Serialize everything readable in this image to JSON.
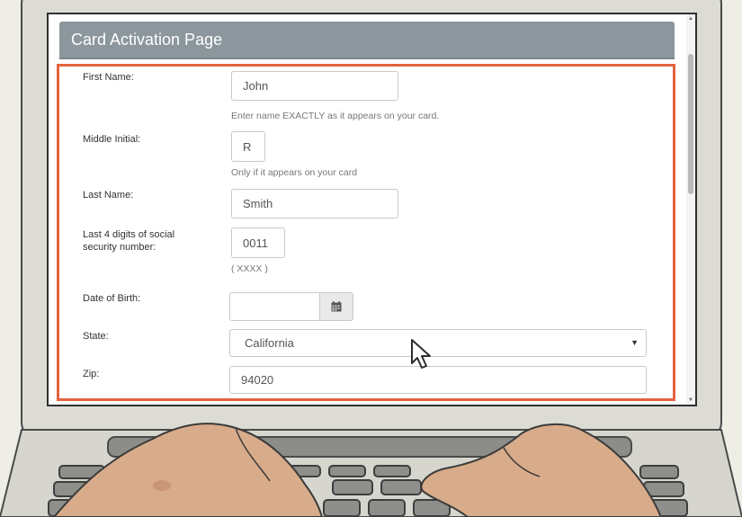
{
  "page_title": "Card Activation Page",
  "form": {
    "first_name": {
      "label": "First Name:",
      "value": "John",
      "help": "Enter name EXACTLY as it appears on your card."
    },
    "middle_initial": {
      "label": "Middle Initial:",
      "value": "R",
      "help": "Only if it appears on your card"
    },
    "last_name": {
      "label": "Last Name:",
      "value": "Smith"
    },
    "ssn_last4": {
      "label_line1": "Last 4 digits of social",
      "label_line2": "security number:",
      "value": "0011",
      "help": "( XXXX )"
    },
    "dob": {
      "label": "Date of Birth:",
      "value": ""
    },
    "state": {
      "label": "State:",
      "value": "California"
    },
    "zip": {
      "label": "Zip:",
      "value": "94020"
    }
  },
  "icons": {
    "calendar": "calendar-icon",
    "dropdown": "chevron-down-icon",
    "cursor": "mouse-pointer-icon"
  },
  "colors": {
    "header": "#8b979c",
    "highlight_frame": "#e4623f",
    "laptop_body": "#d7d7d0",
    "skin": "#d8ab8a"
  }
}
